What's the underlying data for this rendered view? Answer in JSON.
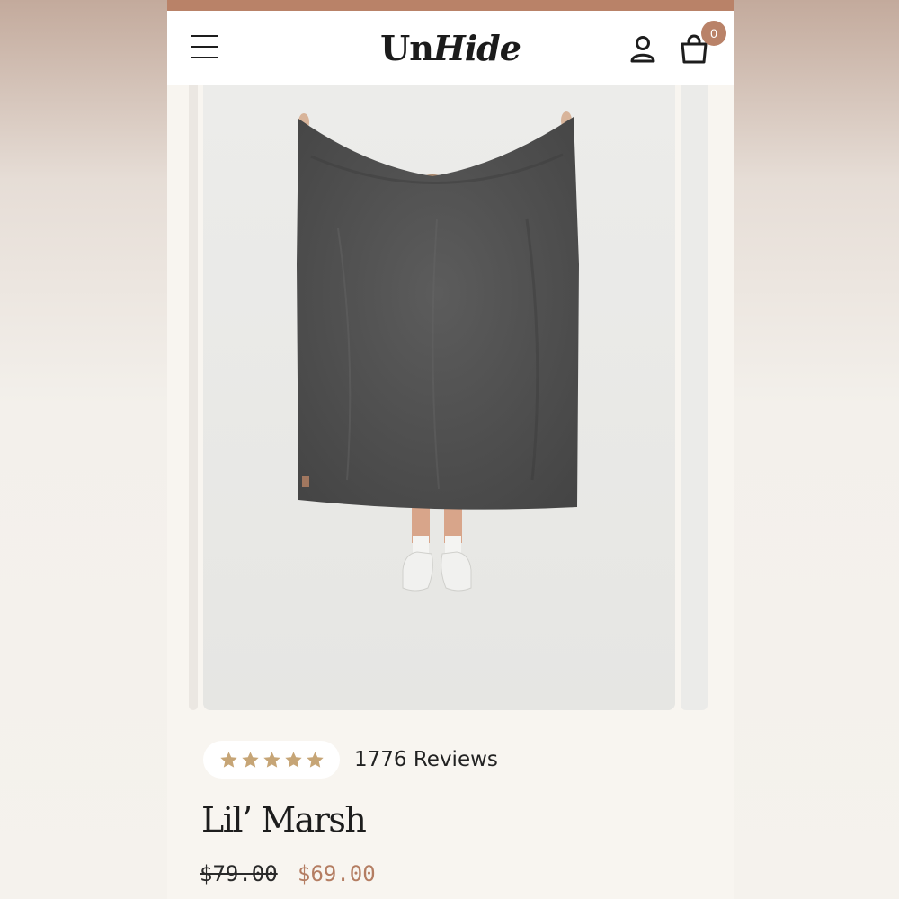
{
  "header": {
    "logo_part1": "Un",
    "logo_part2": "Hide",
    "cart_count": "0",
    "accent_color": "#b98268"
  },
  "icons": {
    "menu": "hamburger-menu-icon",
    "account": "user-icon",
    "cart": "shopping-bag-icon",
    "rating": "star-icon"
  },
  "product": {
    "rating_stars": 5,
    "reviews_label": "1776 Reviews",
    "title": "Lil’ Marsh",
    "price_original": "$79.00",
    "price_sale": "$69.00",
    "sale_color": "#b47d62"
  }
}
